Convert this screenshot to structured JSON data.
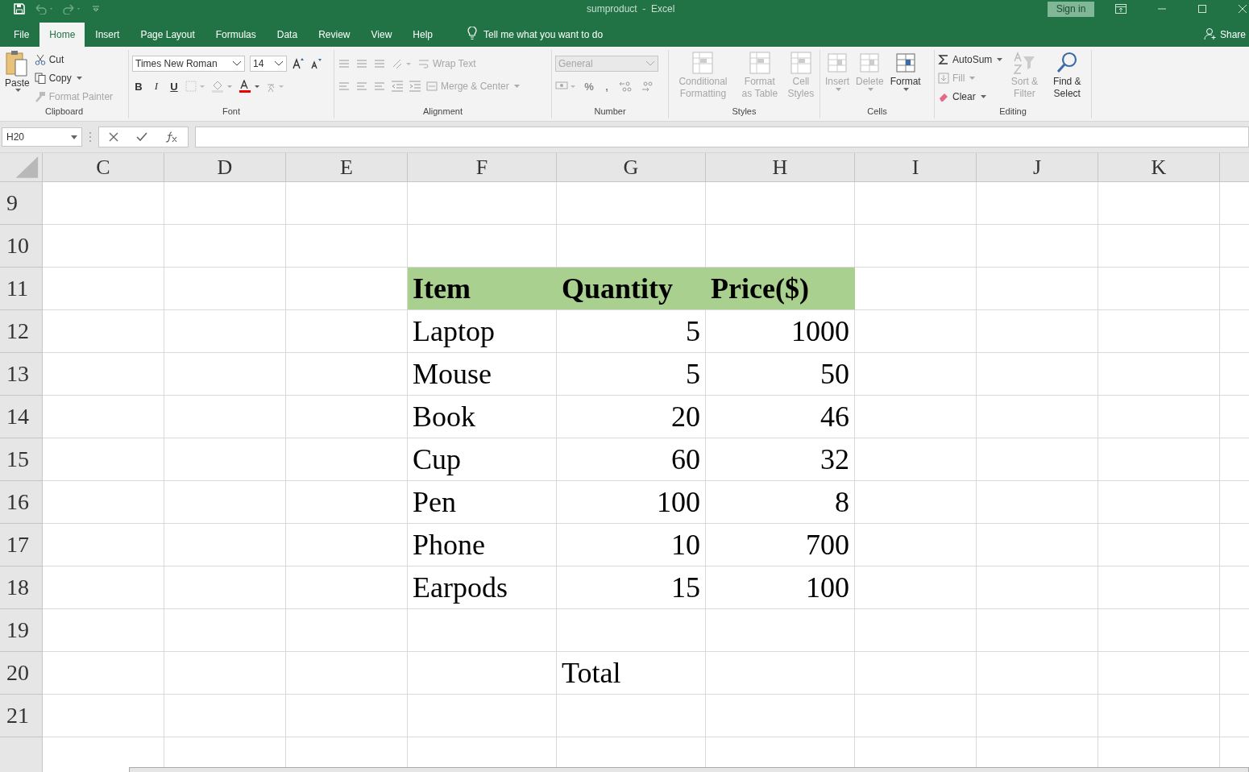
{
  "title_bar": {
    "document_title": "sumproduct  -  Excel",
    "sign_in": "Sign in"
  },
  "menu_tabs": [
    {
      "label": "File",
      "selected": false
    },
    {
      "label": "Home",
      "selected": true
    },
    {
      "label": "Insert",
      "selected": false
    },
    {
      "label": "Page Layout",
      "selected": false
    },
    {
      "label": "Formulas",
      "selected": false
    },
    {
      "label": "Data",
      "selected": false
    },
    {
      "label": "Review",
      "selected": false
    },
    {
      "label": "View",
      "selected": false
    },
    {
      "label": "Help",
      "selected": false
    }
  ],
  "tell_me": "Tell me what you want to do",
  "share": "Share",
  "ribbon": {
    "clipboard": {
      "label": "Clipboard",
      "paste": {
        "label": "Paste",
        "disabled": false
      },
      "cut": {
        "label": "Cut",
        "disabled": false
      },
      "copy": {
        "label": "Copy",
        "disabled": false
      },
      "format_painter": {
        "label": "Format Painter",
        "disabled": true
      }
    },
    "font": {
      "label": "Font",
      "family": "Times New Roman",
      "size": "14",
      "bold": "B",
      "italic": "I",
      "underline": "U"
    },
    "alignment": {
      "label": "Alignment",
      "wrap_text": {
        "label": "Wrap Text",
        "disabled": true
      },
      "merge_center": {
        "label": "Merge & Center",
        "disabled": true
      }
    },
    "number": {
      "label": "Number",
      "format": {
        "value": "General",
        "disabled": true
      },
      "percent": "%",
      "comma": ","
    },
    "styles": {
      "label": "Styles",
      "items": [
        {
          "label": "Conditional Formatting",
          "disabled": true
        },
        {
          "label": "Format as Table",
          "disabled": true
        },
        {
          "label": "Cell Styles",
          "disabled": true
        }
      ]
    },
    "cells": {
      "label": "Cells",
      "items": [
        {
          "label": "Insert",
          "disabled": true
        },
        {
          "label": "Delete",
          "disabled": true
        },
        {
          "label": "Format",
          "disabled": false
        }
      ]
    },
    "editing": {
      "label": "Editing",
      "autosum": {
        "label": "AutoSum",
        "disabled": false
      },
      "fill": {
        "label": "Fill",
        "disabled": true
      },
      "clear": {
        "label": "Clear",
        "disabled": false
      },
      "sort_filter": {
        "label": "Sort & Filter",
        "disabled": true
      },
      "find_select": {
        "label": "Find & Select",
        "disabled": false
      }
    }
  },
  "name_box": "H20",
  "sheet": {
    "columns": [
      "C",
      "D",
      "E",
      "F",
      "G",
      "H",
      "I",
      "J",
      "K"
    ],
    "row_headers": [
      "9",
      "10",
      "11",
      "12",
      "13",
      "14",
      "15",
      "16",
      "17",
      "18",
      "19",
      "20",
      "21"
    ],
    "table_rows": [
      {
        "cells": [
          {
            "value": "Item",
            "kind": "heading"
          },
          {
            "value": "Quantity",
            "kind": "heading"
          },
          {
            "value": "Price($)",
            "kind": "heading"
          }
        ]
      },
      {
        "cells": [
          {
            "value": "Laptop",
            "kind": "text"
          },
          {
            "value": "5",
            "kind": "number"
          },
          {
            "value": "1000",
            "kind": "number"
          }
        ]
      },
      {
        "cells": [
          {
            "value": "Mouse",
            "kind": "text"
          },
          {
            "value": "5",
            "kind": "number"
          },
          {
            "value": "50",
            "kind": "number"
          }
        ]
      },
      {
        "cells": [
          {
            "value": "Book",
            "kind": "text"
          },
          {
            "value": "20",
            "kind": "number"
          },
          {
            "value": "46",
            "kind": "number"
          }
        ]
      },
      {
        "cells": [
          {
            "value": "Cup",
            "kind": "text"
          },
          {
            "value": "60",
            "kind": "number"
          },
          {
            "value": "32",
            "kind": "number"
          }
        ]
      },
      {
        "cells": [
          {
            "value": "Pen",
            "kind": "text"
          },
          {
            "value": "100",
            "kind": "number"
          },
          {
            "value": "8",
            "kind": "number"
          }
        ]
      },
      {
        "cells": [
          {
            "value": "Phone",
            "kind": "text"
          },
          {
            "value": "10",
            "kind": "number"
          },
          {
            "value": "700",
            "kind": "number"
          }
        ]
      },
      {
        "cells": [
          {
            "value": "Earpods",
            "kind": "text"
          },
          {
            "value": "15",
            "kind": "number"
          },
          {
            "value": "100",
            "kind": "number"
          }
        ]
      },
      {
        "cells": [
          null,
          null,
          null
        ]
      },
      {
        "cells": [
          null,
          {
            "value": "Total",
            "kind": "text"
          },
          null
        ]
      }
    ]
  }
}
